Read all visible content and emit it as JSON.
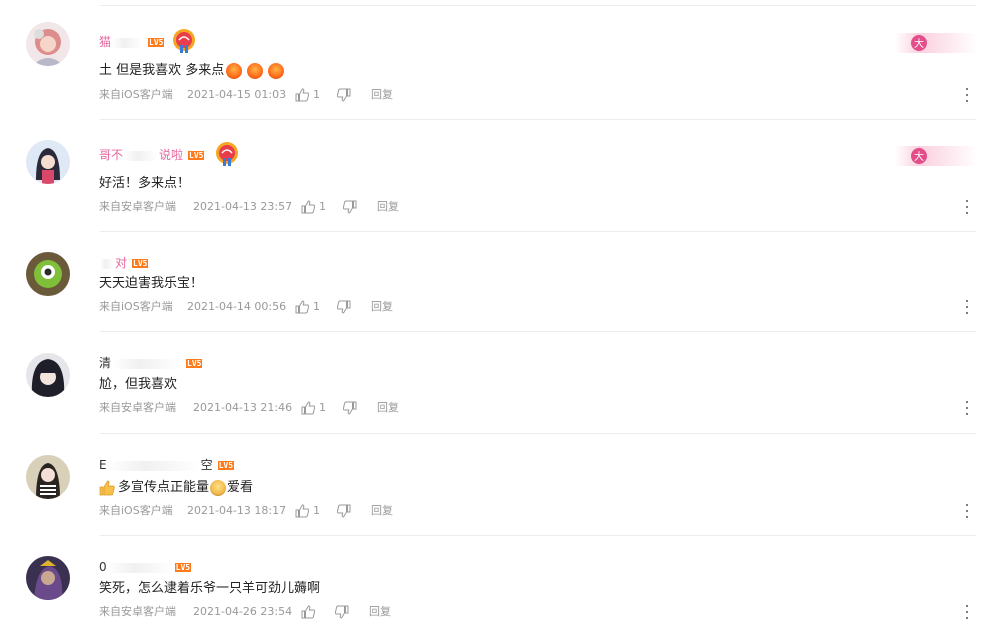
{
  "colors": {
    "level_badge": "#ff7a1a",
    "name_pink": "#e8679f",
    "meta": "#999999"
  },
  "comments": [
    {
      "name": "猫",
      "name_color": "#e8679f",
      "level": "LV5",
      "fan_badge": true,
      "da_badge": true,
      "text": "土 但是我喜欢 多来点",
      "emojis": 3,
      "source": "来自iOS客户端",
      "time": "2021-04-15 01:03",
      "likes": "1",
      "reply": "回复"
    },
    {
      "name_prefix": "哥不",
      "name_suffix": "说啦",
      "name_color": "#e8679f",
      "level": "LV5",
      "fan_badge": true,
      "da_badge": true,
      "text": "好活！多来点！",
      "source": "来自安卓客户端",
      "time": "2021-04-13 23:57",
      "likes": "1",
      "reply": "回复"
    },
    {
      "name": "对",
      "name_color": "#e8679f",
      "level": "LV5",
      "text": "天天迫害我乐宝！",
      "source": "来自iOS客户端",
      "time": "2021-04-14 00:56",
      "likes": "1",
      "reply": "回复"
    },
    {
      "name": "清",
      "name_color": "#333333",
      "level": "LV5",
      "text": "尬，但我喜欢",
      "source": "来自安卓客户端",
      "time": "2021-04-13 21:46",
      "likes": "1",
      "reply": "回复"
    },
    {
      "name_prefix": "E",
      "name_suffix": "空",
      "name_color": "#333333",
      "level": "LV5",
      "text": "多宣传点正能量",
      "text_tail": "爱看",
      "source": "来自iOS客户端",
      "time": "2021-04-13 18:17",
      "likes": "1",
      "reply": "回复"
    },
    {
      "name": "0",
      "name_color": "#333333",
      "level": "LV5",
      "text": "笑死，怎么逮着乐爷一只羊可劲儿薅啊",
      "source": "来自安卓客户端",
      "time": "2021-04-26 23:54",
      "likes": "",
      "reply": "回复"
    }
  ]
}
